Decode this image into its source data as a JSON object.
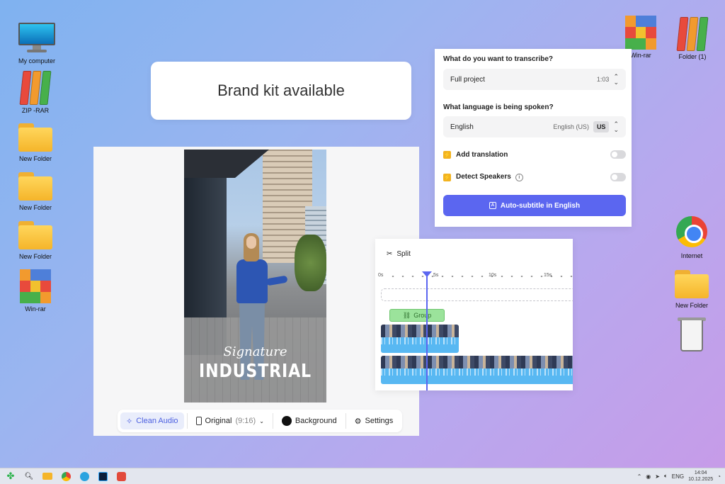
{
  "desktop": {
    "left_icons": [
      {
        "label": "My computer"
      },
      {
        "label": "ZIP -RAR"
      },
      {
        "label": "New Folder"
      },
      {
        "label": "New Folder"
      },
      {
        "label": "New Folder"
      },
      {
        "label": "Win-rar"
      }
    ],
    "right_icons": [
      {
        "label": "Win-rar"
      },
      {
        "label": "Folder (1)"
      },
      {
        "label": "Internet"
      },
      {
        "label": "New Folder"
      }
    ]
  },
  "banner": {
    "text": "Brand kit available"
  },
  "video": {
    "overlay_script": "Signature",
    "overlay_title": "INDUSTRIAL"
  },
  "toolbar": {
    "clean_audio": "Clean Audio",
    "aspect": "Original",
    "aspect_ratio": "(9:16)",
    "background": "Background",
    "settings": "Settings"
  },
  "transcribe": {
    "question1": "What do you want to transcribe?",
    "scope_value": "Full project",
    "scope_duration": "1:03",
    "question2": "What language is being spoken?",
    "language_value": "English",
    "language_variant": "English (US)",
    "language_code": "US",
    "add_translation": "Add translation",
    "detect_speakers": "Detect Speakers",
    "cta": "Auto-subtitle in English",
    "accent_color": "#5b66f0"
  },
  "timeline": {
    "split_label": "Split",
    "ticks": [
      "0s",
      "5s",
      "10s",
      "15s"
    ],
    "group_label": "Group"
  },
  "taskbar": {
    "language": "ENG",
    "time": "14:04",
    "date": "10.12.2025"
  }
}
